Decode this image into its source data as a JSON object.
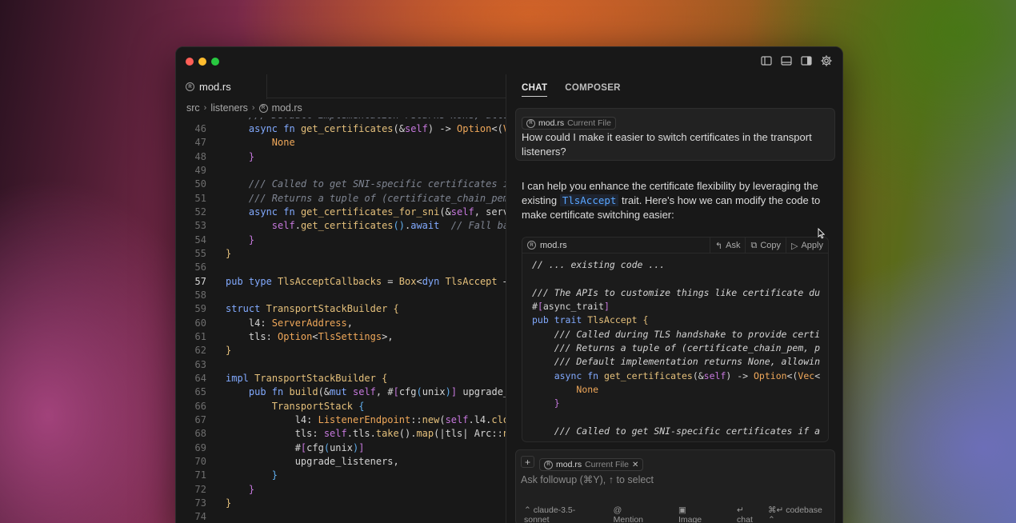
{
  "window": {
    "dots": [
      "#ff5f57",
      "#febc2e",
      "#28c840"
    ]
  },
  "editor": {
    "tab": "mod.rs",
    "breadcrumb": [
      "src",
      "listeners",
      "mod.rs"
    ],
    "current_line": "57",
    "lines": [
      {
        "n": "46"
      },
      {
        "n": "47"
      },
      {
        "n": "48"
      },
      {
        "n": "49"
      },
      {
        "n": "50"
      },
      {
        "n": "51"
      },
      {
        "n": "52"
      },
      {
        "n": "53"
      },
      {
        "n": "54"
      },
      {
        "n": "55"
      },
      {
        "n": "56"
      },
      {
        "n": "57"
      },
      {
        "n": "58"
      },
      {
        "n": "59"
      },
      {
        "n": "60"
      },
      {
        "n": "61"
      },
      {
        "n": "62"
      },
      {
        "n": "63"
      },
      {
        "n": "64"
      },
      {
        "n": "65"
      },
      {
        "n": "66"
      },
      {
        "n": "67"
      },
      {
        "n": "68"
      },
      {
        "n": "69"
      },
      {
        "n": "70"
      },
      {
        "n": "71"
      },
      {
        "n": "72"
      },
      {
        "n": "73"
      },
      {
        "n": "74"
      }
    ]
  },
  "chat": {
    "tabs": [
      "CHAT",
      "COMPOSER"
    ],
    "question_file": "mod.rs",
    "question_file_tag": "Current File",
    "question": "How could I make it easier to switch certificates in the transport listeners?",
    "answer_pre": "I can help you enhance the certificate flexibility by leveraging the existing ",
    "answer_ident": "TlsAccept",
    "answer_post": " trait. Here's how we can modify the code to make certificate switching easier:",
    "codeblock": {
      "file": "mod.rs",
      "ask": "Ask",
      "copy": "Copy",
      "apply": "Apply"
    },
    "input": {
      "file": "mod.rs",
      "file_tag": "Current File",
      "placeholder": "Ask followup (⌘Y), ↑ to select",
      "model": "claude-3.5-sonnet",
      "mention": "Mention",
      "image": "Image",
      "chat": "chat",
      "codebase": "codebase"
    }
  }
}
